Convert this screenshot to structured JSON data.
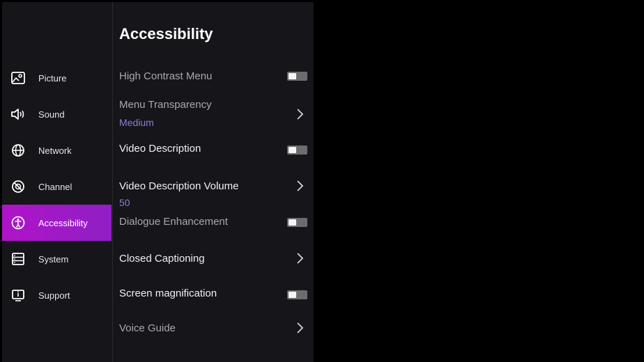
{
  "sidebar": {
    "items": [
      {
        "label": "Picture",
        "icon": "picture-icon",
        "active": false
      },
      {
        "label": "Sound",
        "icon": "speaker-icon",
        "active": false
      },
      {
        "label": "Network",
        "icon": "globe-icon",
        "active": false
      },
      {
        "label": "Channel",
        "icon": "channel-icon",
        "active": false
      },
      {
        "label": "Accessibility",
        "icon": "accessibility-icon",
        "active": true
      },
      {
        "label": "System",
        "icon": "system-icon",
        "active": false
      },
      {
        "label": "Support",
        "icon": "support-icon",
        "active": false
      }
    ]
  },
  "main": {
    "title": "Accessibility",
    "settings": [
      {
        "label": "High Contrast Menu",
        "control": "toggle",
        "state": "off"
      },
      {
        "label": "Menu Transparency",
        "value": "Medium",
        "control": "chevron"
      },
      {
        "label": "Video Description",
        "control": "toggle",
        "state": "off"
      },
      {
        "label": "Video Description Volume",
        "value": "50",
        "control": "chevron"
      },
      {
        "label": "Dialogue Enhancement",
        "control": "toggle",
        "state": "off"
      },
      {
        "label": "Closed Captioning",
        "control": "chevron"
      },
      {
        "label": "Screen magnification",
        "control": "toggle",
        "state": "off"
      },
      {
        "label": "Voice Guide",
        "control": "chevron"
      }
    ]
  },
  "colors": {
    "accent_active": "#b014c8",
    "value_text": "#8f7cd6",
    "panel_bg": "#15151a"
  }
}
